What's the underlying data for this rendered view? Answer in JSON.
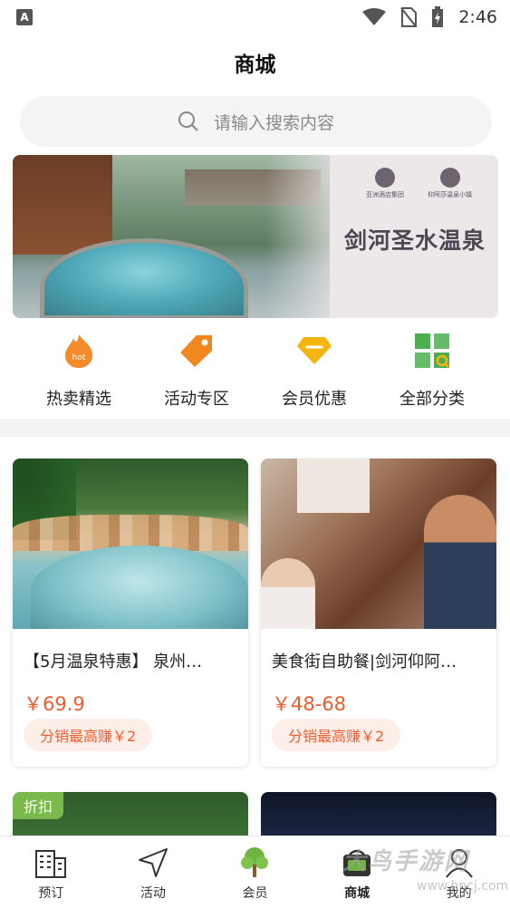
{
  "status_bar": {
    "time": "2:46",
    "left_icon_letter": "A"
  },
  "header": {
    "title": "商城"
  },
  "search": {
    "placeholder": "请输入搜索内容"
  },
  "banner": {
    "title": "剑河圣水温泉",
    "logo1_text": "亚洲酒店集团",
    "logo2_text": "仰阿莎温泉小镇"
  },
  "categories": [
    {
      "label": "热卖精选",
      "icon": "hot-fire-icon",
      "color": "#f58a2a"
    },
    {
      "label": "活动专区",
      "icon": "tag-icon",
      "color": "#f0871f"
    },
    {
      "label": "会员优惠",
      "icon": "gem-icon",
      "color": "#f5b50f"
    },
    {
      "label": "全部分类",
      "icon": "grid-icon",
      "color": "#4caf50"
    }
  ],
  "products": [
    {
      "title": "【5月温泉特惠】 泉州…",
      "price": "￥69.9",
      "badge": "分销最高赚￥2"
    },
    {
      "title": "美食街自助餐|剑河仰阿…",
      "price": "￥48-68",
      "badge": "分销最高赚￥2"
    }
  ],
  "next_row": {
    "tag": "折扣"
  },
  "bottom_nav": [
    {
      "label": "预订",
      "icon": "building-icon"
    },
    {
      "label": "活动",
      "icon": "navigation-arrow-icon"
    },
    {
      "label": "会员",
      "icon": "tree-icon"
    },
    {
      "label": "商城",
      "icon": "shop-icon",
      "active": true
    },
    {
      "label": "我的",
      "icon": "user-icon"
    }
  ],
  "watermark": {
    "text": "大鸟手游网",
    "sub": "www.hncj.com"
  },
  "colors": {
    "price": "#f25a2a",
    "badge_bg": "#fdefe8",
    "discount_tag": "#7ab94b"
  }
}
